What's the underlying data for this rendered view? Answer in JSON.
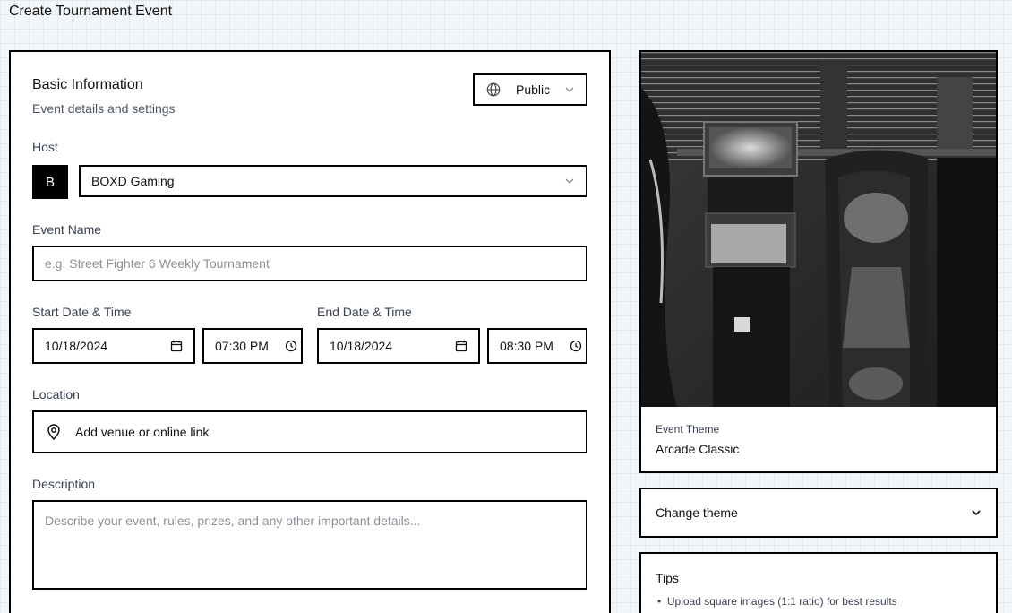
{
  "page_title": "Create Tournament Event",
  "basic_info": {
    "title": "Basic Information",
    "subtitle": "Event details and settings",
    "visibility": {
      "icon": "globe-icon",
      "label": "Public"
    }
  },
  "host": {
    "label": "Host",
    "avatar_letter": "B",
    "selected": "BOXD Gaming"
  },
  "event_name": {
    "label": "Event Name",
    "placeholder": "e.g. Street Fighter 6 Weekly Tournament",
    "value": ""
  },
  "start": {
    "label": "Start Date & Time",
    "date": "10/18/2024",
    "time": "07:30 PM"
  },
  "end": {
    "label": "End Date & Time",
    "date": "10/18/2024",
    "time": "08:30 PM"
  },
  "location": {
    "label": "Location",
    "value": "Add venue or online link"
  },
  "description": {
    "label": "Description",
    "placeholder": "Describe your event, rules, prizes, and any other important details..."
  },
  "theme": {
    "caption": "Event Theme",
    "name": "Arcade Classic",
    "change_label": "Change theme"
  },
  "tips": {
    "title": "Tips",
    "items": [
      "Upload square images (1:1 ratio) for best results"
    ]
  },
  "colors": {
    "border": "#000000",
    "text_primary": "#111111",
    "text_muted": "#4b5563",
    "placeholder": "#8b8f96"
  }
}
